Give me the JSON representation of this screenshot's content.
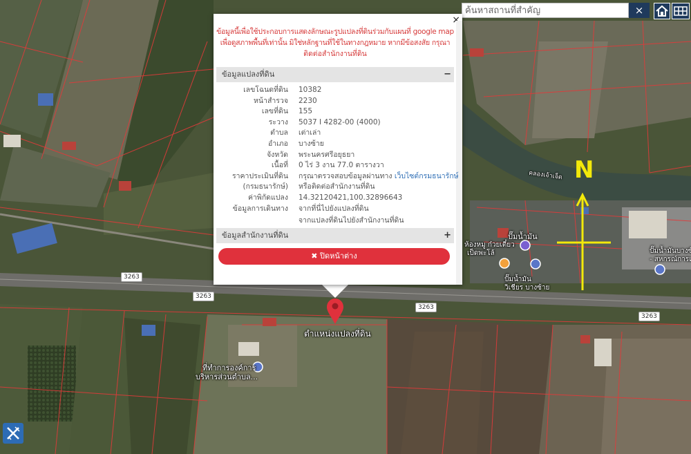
{
  "search": {
    "placeholder": "ค้นหาสถานที่สำคัญ",
    "clear_label": "×"
  },
  "popup": {
    "close_label": "×",
    "notice_lines": [
      "ข้อมูลนี้เพื่อใช้ประกอบการแสดงลักษณะรูปแปลงที่ดินร่วมกับแผนที่ google map",
      "เพื่อดูสภาพพื้นที่เท่านั้น มิใช่หลักฐานที่ใช้ในทางกฎหมาย หากมีข้อสงสัย กรุณา",
      "ติดต่อสำนักงานที่ดิน"
    ],
    "land_section_title": "ข้อมูลแปลงที่ดิน",
    "land_section_toggle": "−",
    "fields": {
      "deed_no": {
        "label": "เลขโฉนดที่ดิน",
        "value": "10382"
      },
      "survey_page": {
        "label": "หน้าสำรวจ",
        "value": "2230"
      },
      "land_no": {
        "label": "เลขที่ดิน",
        "value": "155"
      },
      "sheet": {
        "label": "ระวาง",
        "value": "5037 I 4282-00 (4000)"
      },
      "subdistrict": {
        "label": "ตำบล",
        "value": "เต่าเล่า"
      },
      "district": {
        "label": "อำเภอ",
        "value": "บางซ้าย"
      },
      "province": {
        "label": "จังหวัด",
        "value": "พระนครศรีอยุธยา"
      },
      "area": {
        "label": "เนื้อที่",
        "value": "0 ไร่ 3 งาน 77.0 ตารางวา"
      },
      "appraisal": {
        "label_1": "ราคาประเมินที่ดิน",
        "label_2": "(กรมธนารักษ์)",
        "value_1": "กรุณาตรวจสอบข้อมูลผ่านทาง",
        "link": "เว็บไซต์กรมธนารักษ์",
        "value_2": "หรือติดต่อสำนักงานที่ดิน"
      },
      "coordinates": {
        "label": "ค่าพิกัดแปลง",
        "value": "14.32120421,100.32896643"
      },
      "directions": {
        "label": "ข้อมูลการเดินทาง",
        "link_1": "จากที่นี่ไปยังแปลงที่ดิน",
        "link_2": "จากแปลงที่ดินไปยังสำนักงานที่ดิน"
      }
    },
    "office_section_title": "ข้อมูลสำนักงานที่ดิน",
    "office_section_toggle": "+",
    "close_button": "✖ ปิดหน้าต่าง"
  },
  "map": {
    "marker_label": "ตำแหน่งแปลงที่ดิน",
    "road_number": "3263",
    "north_label": "N",
    "places": {
      "canal": "คลองเจ้าเจ็ด",
      "fuel": "ปั๊มน้ำมัน",
      "noodle": "ก๋วยเตี๋ยว",
      "noodle_2": "ห้องหมู ก๋วยเตี๋ยว",
      "noodle_3": "เป็ดพะโล้",
      "gas": "ปั๊มน้ำมัน",
      "school": "วิเชียร บางซ้าย",
      "station_right_1": "ปั๊มน้ำมันบางซ้าย",
      "station_right_2": "- สหกรณ์การเกษ",
      "gov_1": "ที่ทำการองค์การ",
      "gov_2": "บริหารส่วนตำบล..."
    }
  }
}
